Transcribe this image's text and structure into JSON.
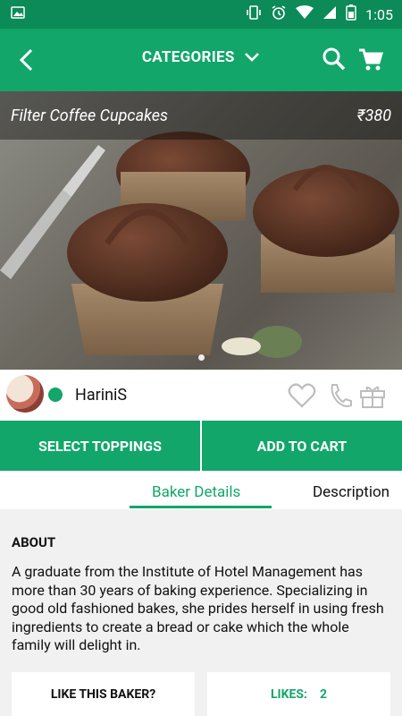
{
  "status": {
    "time": "1:05"
  },
  "appbar": {
    "title": "CATEGORIES"
  },
  "product": {
    "name": "Filter Coffee Cupcakes",
    "price": "₹380"
  },
  "baker": {
    "name": "HariniS"
  },
  "actions": {
    "select_toppings": "SELECT TOPPINGS",
    "add_to_cart": "ADD TO CART"
  },
  "tabs": {
    "baker_details": "Baker Details",
    "description": "Description"
  },
  "about": {
    "heading": "ABOUT",
    "text": "A graduate from the Institute of Hotel Management has more than 30 years of baking experience. Specializing in good old fashioned bakes, she prides herself in using fresh ingredients to create a bread or cake which the whole family will delight in."
  },
  "cards": {
    "like_label": "LIKE THIS BAKER?",
    "likes_label": "LIKES:",
    "likes_value": "2"
  },
  "colors": {
    "primary": "#12a66a",
    "status_bar": "#0c8a57"
  }
}
